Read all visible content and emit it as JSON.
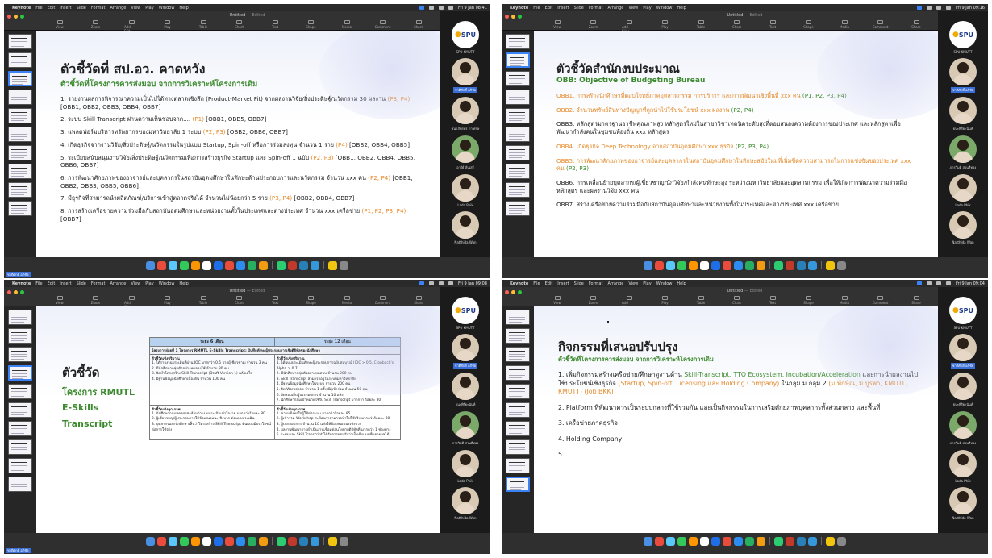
{
  "os": {
    "app_name": "Keynote",
    "menus": [
      "File",
      "Edit",
      "Insert",
      "Slide",
      "Format",
      "Arrange",
      "View",
      "Play",
      "Window",
      "Help"
    ],
    "clocks": [
      "Fri 9 Jan 08:41",
      "Fri 9 Jan 09:16",
      "Fri 9 Jan 09:08",
      "Fri 9 Jan 09:04"
    ]
  },
  "toolbar": {
    "doc_title": "Untitled",
    "doc_status": "— Edited",
    "tools": [
      "View",
      "Zoom",
      "Add Slide",
      "Play",
      "Table",
      "Chart",
      "Text",
      "Shape",
      "Media",
      "Comment",
      "Share"
    ],
    "right_tools": [
      "Format",
      "Animate",
      "Document"
    ]
  },
  "participants": {
    "logo_text": "SPU",
    "logo_label": "SPU KMUTT",
    "names_q0": [
      "ชาติศักดิ์ อภิชัย",
      "ชนาภัทรพร ภาเศรษ",
      "อารีย์ ลั่นเสรี",
      "Lada Phik",
      "Natthida Wan"
    ],
    "names_q1": [
      "ชาติศักดิ์ อภิชัย",
      "ธนะพิริยะนันท์",
      "ภารวิมดี สวนสีทอง",
      "Lada Phik",
      "Natthida Wan"
    ],
    "names_q2": [
      "ชาติศักดิ์ อภิชัย",
      "ธนะพิริยะนันท์",
      "ภารวิมดี สวนสีทอง",
      "Lada Phik",
      "Natthida Wan"
    ],
    "names_q3": [
      "ชาติศักดิ์ อภิชัย",
      "ธนะพิริยะนันท์",
      "ภารวิมดี สวนสีทอง",
      "Lada Phik",
      "Natthida Wan"
    ]
  },
  "dock_label": "ชาติศักดิ์ อภิชัย",
  "slide0": {
    "title": "ตัวชี้วัดที่ สป.อว. คาดหวัง",
    "subtitle": "ตัวชี้วัดที่โครงการควรส่งมอบ จากการวิเคราะห์โครงการเดิม",
    "items": [
      {
        "text": "1. รายงานผลการพิจารณาความเป็นไปได้ทางตลาดเชิงลึก (Product-Market Fit) จากผลงานวิจัย/สิ่งประดิษฐ์/นวัตกรรม 30 ผลงาน ",
        "tag": "(P3, P4)",
        "refs": " [OBB1, OBB2, OBB3, OBB4, OBB7]"
      },
      {
        "text": "2. ระบบ Skill Transcript ผ่านความเห็นชอบจาก.... ",
        "tag": "(P1)",
        "refs": " [OBB1, OBB5, OBB7]"
      },
      {
        "text": "3. แพลตฟอร์มบริหารทรัพยากรของมหาวิทยาลัย 1 ระบบ ",
        "tag": "(P2, P3)",
        "refs": " [OBB2, OBB6, OBB7]"
      },
      {
        "text": "4. เกิดธุรกิจจากงานวิจัย/สิ่งประดิษฐ์/นวัตกรรมในรูปแบบ Startup, Spin-off หรือการร่วมลงทุน จำนวน 1 ราย ",
        "tag": "(P4)",
        "refs": " [OBB2, OBB4, OBB5]"
      },
      {
        "text": "5. ระเบียบสนับสนุนงานวิจัย/สิ่งประดิษฐ์/นวัตกรรมเพื่อการสร้างธุรกิจ Startup และ Spin-off 1 ฉบับ ",
        "tag": "(P2, P3)",
        "refs": " [OBB1, OBB2, OBB4, OBB5, OBB6, OBB7]"
      },
      {
        "text": "6. การพัฒนาศักยภาพของอาจารย์และบุคลากรในสถาบันอุดมศึกษาในทักษะด้านประกอบการและนวัตกรรม จำนวน xxx คน ",
        "tag": "(P2, P4)",
        "refs": " [OBB1, OBB2, OBB3, OBB5, OBB6]"
      },
      {
        "text": "7. มีธุรกิจที่สามารถนำผลิตภัณฑ์/บริการเข้าสู่ตลาดจริงได้ จำนวนไม่น้อยกว่า 5 ราย ",
        "tag": "(P3, P4)",
        "refs": " [OBB2, OBB4, OBB7]"
      },
      {
        "text": "8. การสร้างเครือข่ายความร่วมมือกับสถาบันอุดมศึกษาและหน่วยงานทั้งในประเทศและต่างประเทศ จำนวน xxx เครือข่าย ",
        "tag": "(P1, P2, P3, P4)",
        "refs": " [OBB7]"
      }
    ]
  },
  "slide1": {
    "title": "ตัวชี้วัดสำนักงบประมาณ",
    "subtitle": "OBB: Objective of Budgeting Bureau",
    "items": [
      {
        "text": "OBB1. การสร้างนักศึกษาที่ตอบโจทย์ภาคอุตสาหกรรม การบริการ และการพัฒนาเชิงพื้นที่ xxx คน ",
        "tag": "(P1, P2, P3, P4)",
        "color": "orange"
      },
      {
        "text": "OBB2. จำนวนทรัพย์สินทางปัญญาที่ถูกนำไปใช้ประโยชน์ xxx ผลงาน ",
        "tag": "(P2, P4)",
        "color": "orange"
      },
      {
        "text": "OBB3. หลักสูตรมาตรฐานอาชีพคุณภาพสูง หลักสูตรใหม่ในสาขาวิชาเทคนิคระดับสูงที่ตอบสนองความต้องการของประเทศ และหลักสูตรเพื่อพัฒนากำลังคนในชุมชนท้องถิ่น xxx หลักสูตร",
        "tag": "",
        "color": "black"
      },
      {
        "text": "OBB4. เกิดธุรกิจ Deep Technology จากสถาบันอุดมศึกษา xxx ธุรกิจ ",
        "tag": "(P2, P3, P4)",
        "color": "orange"
      },
      {
        "text": "OBB5. การพัฒนาศักยภาพของอาจารย์และบุคลากรในสถาบันอุดมศึกษาในทักษะสมัยใหม่ที่เพิ่มขีดความสามารถในการแข่งขันของประเทศ xxx คน ",
        "tag": "(P2, P3)",
        "color": "orange"
      },
      {
        "text": "OBB6. การเคลื่อนย้ายบุคลากร/ผู้เชี่ยวชาญ/นักวิจัย/กำลังคนทักษะสูง ระหว่างมหาวิทยาลัยและอุตสาหกรรม เพื่อให้เกิดการพัฒนาความร่วมมือ หลักสูตร และผลงานวิจัย xxx คน",
        "tag": "",
        "color": "black"
      },
      {
        "text": "OBB7. สร้างเครือข่ายความร่วมมือกับสถาบันอุดมศึกษาและหน่วยงานทั้งในประเทศและต่างประเทศ xxx เครือข่าย",
        "tag": "",
        "color": "black"
      }
    ]
  },
  "slide2": {
    "title": "ตัวชี้วัด",
    "lines": [
      "โครงการ RMUTL",
      "E-Skills",
      "Transcript"
    ],
    "table": {
      "col_headers": [
        "ระยะ 6 เดือน",
        "ระยะ 12 เดือน"
      ],
      "merged_row": "โครงการย่อยที่ 1 โครงการ RMUTL E-Skills Transcript: บันทึกทักษะผู้ประกอบการเชิงดิจิทัลของนักศึกษา",
      "quant_title": "ตัวชี้วัดเชิงปริมาณ",
      "qual_title": "ตัวชี้วัดเชิงคุณภาพ",
      "q6": [
        "1. ได้รายงานประเมินที่ผ่าน IOC มากกว่า 0.5 จากผู้เชี่ยวชาญ จำนวน 3 คน",
        "2. มีนักศึกษากลุ่มตัวอย่างทดลองใช้ จำนวน 80 คน",
        "3. จัดทำโครงสร้าง Skill Transcript (Draft Version 1) แล้วเสร็จ",
        "4. มีฐานข้อมูลนักศึกษาเบื้องต้น จำนวน 100 คน"
      ],
      "q12": [
        "1. ได้แบบประเมินทักษะผู้ประกอบการฉบับสมบูรณ์ (IOC > 0.5, Cronbach's Alpha > 0.7)",
        "2. มีนักศึกษากลุ่มตัวอย่างทดสอบ จำนวน 200 คน",
        "3. Skill Transcript สามารถอยู่ในระบบมหาวิทยาลัย",
        "4. มีฐานข้อมูลนักศึกษาในระบบ จำนวน 200 คน",
        "5. จัด Workshop จำนวน 1 ครั้ง มีผู้เข้าร่วม จำนวน 50 คน",
        "6. จัดสอบเก็บผู้ประกอบการ จำนวน 10 แห่ง",
        "7. นักศึกษากลุ่มเป้าหมายใช้รับ Skill Transcript มากกว่า ร้อยละ 80"
      ],
      "l6": [
        "1. นักศึกษากลุ่มทดลองสะท้อนว่าแบบประเมินเข้าใจง่าย มากกว่าร้อยละ 80",
        "2. ผู้เชี่ยวชาญ/ผู้ประกอบการให้ข้อเสนอแนะเชิงบวก ต่อแบบประเมิน",
        "3. บุคลากรและนักศึกษาเห็นว่าโครงสร้าง Skill Transcript ต้นแบบมีประโยชน์ต่อการใช้จริง"
      ],
      "l12": [
        "1. ความพึงพอใจผู้ใช้ต่อระบบ มากกว่าร้อยละ 85",
        "2. ผู้เข้าร่วม Workshop สะท้อนว่าสามารถนำไปใช้จริง มากกว่าร้อยละ 80",
        "3. ผู้ประกอบการ จำนวน 10 แห่งให้ข้อเสนอแนะเชิงบวก",
        "4. ผลงานพัฒนาการดำเนินงานเชื่อมต่อนโยบายดิจิทัลที่ มากกว่า 1 ช่องทาง",
        "5. ระบบและ Skill Transcript ได้รับการยอมรับว่าเป็นต้นแบบที่ขยายผลได้"
      ]
    }
  },
  "slide3": {
    "title": "กิจกรรมที่เสนอปรับปรุง",
    "subtitle": "ตัวชี้วัดที่โครงการควรส่งมอบ จากการวิเคราะห์โครงการเดิม",
    "item1": {
      "a": "1. เพิ่มกิจกรรมสร้างเครือข่าย/ศึกษาดูงานด้าน ",
      "b": "Skill-Transcript, TTO Ecosystem, Incubation/Acceleration",
      "c": " และการนำผลงานไปใช้ประโยชน์เชิงธุรกิจ ",
      "d": "(Startup, Spin-off, Licensing และ Holding Company)",
      "e": " ในกลุ่ม ม.กลุ่ม 2 ",
      "f": "(ม.ทักษิณ, ม.บูรพา, KMUTL, KMUTT) (Job BKK)"
    },
    "items": [
      "2. Platform ที่พัฒนาควรเป็นระบบกลางที่ใช้ร่วมกัน และเป็นกิจกรรมในการเสริมศักยภาพบุคลากรทั้งส่วนกลาง และพื้นที่",
      "3. เครือข่ายภาคธุรกิจ",
      "4. Holding Company",
      "5. ..."
    ]
  },
  "colors": {
    "title": "#1f1f1f",
    "subtitle_green": "#3c8a2e",
    "tag_orange": "#e58a2a",
    "keynote_select": "#3b82f6"
  }
}
